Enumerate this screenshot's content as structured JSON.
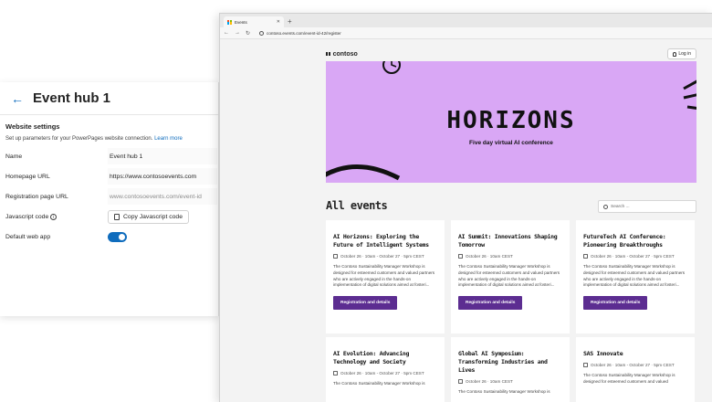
{
  "settings": {
    "title": "Event hub 1",
    "section_title": "Website settings",
    "description": "Set up parameters for your PowerPages website connection.",
    "learn_more": "Learn more",
    "fields": [
      {
        "label": "Name",
        "value": "Event hub 1"
      },
      {
        "label": "Homepage URL",
        "value": "https://www.contosoevents.com"
      },
      {
        "label": "Registration page URL",
        "placeholder": "www.contosoevents.com/event-id"
      },
      {
        "label": "Javascript code",
        "button": "Copy Javascript code"
      },
      {
        "label": "Default web app",
        "toggle_on": true
      }
    ]
  },
  "browser": {
    "tab_title": "Events",
    "url": "contoso.events.com/event-id-42/register"
  },
  "site": {
    "logo": "contoso",
    "login": "Log in",
    "hero_title": "HORIZONS",
    "hero_subtitle": "Five day virtual AI conference",
    "hero_color": "#d9a7f5",
    "section_heading": "All events",
    "search_placeholder": "Search ...",
    "button_color": "#5c2d91",
    "cards": [
      {
        "title": "AI Horizons: Exploring the Future of Intelligent Systems",
        "date": "October 26 · 10am - October 27 · 5pm CEST",
        "desc": "The Contoso Sustainability Manager Workshop is designed for esteemed customers and valued partners who are actively engaged in the hands-on implementation of digital solutions aimed at fosteri...",
        "button": "Registration and details"
      },
      {
        "title": "AI Summit: Innovations Shaping Tomorrow",
        "date": "October 26 · 10am CEST",
        "desc": "The Contoso Sustainability Manager Workshop is designed for esteemed customers and valued partners who are actively engaged in the hands-on implementation of digital solutions aimed at fosteri...",
        "button": "Registration and details"
      },
      {
        "title": "FutureTech AI Conference: Pioneering Breakthroughs",
        "date": "October 26 · 10am - October 27 · 5pm CEST",
        "desc": "The Contoso Sustainability Manager Workshop is designed for esteemed customers and valued partners who are actively engaged in the hands-on implementation of digital solutions aimed at fosteri...",
        "button": "Registration and details"
      },
      {
        "title": "AI Evolution: Advancing Technology and Society",
        "date": "October 26 · 10am - October 27 · 5pm CEST",
        "desc": "The Contoso Sustainability Manager Workshop is"
      },
      {
        "title": "Global AI Symposium: Transforming Industries and Lives",
        "date": "October 26 · 10am CEST",
        "desc": "The Contoso Sustainability Manager Workshop is"
      },
      {
        "title": "SAS Innovate",
        "date": "October 26 · 10am - October 27 · 5pm CEST",
        "desc": "The Contoso Sustainability Manager Workshop is designed for esteemed customers and valued"
      }
    ]
  }
}
